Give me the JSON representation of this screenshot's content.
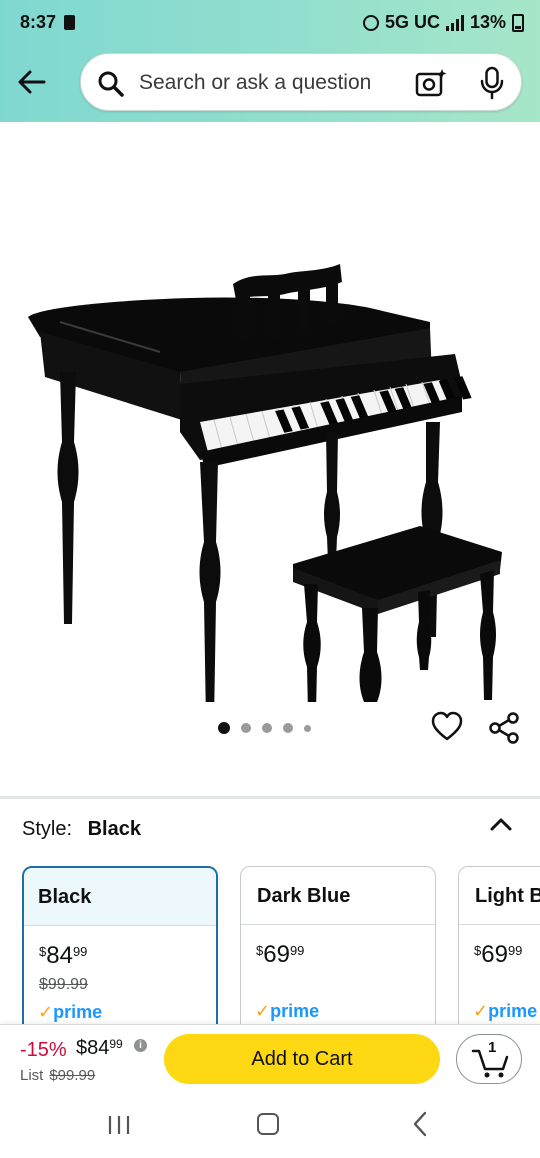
{
  "status_bar": {
    "time": "8:37",
    "network": "5G UC",
    "battery": "13%"
  },
  "search": {
    "placeholder": "Search or ask a question"
  },
  "icons": {
    "back": "back-arrow-icon",
    "search": "search-icon",
    "camera": "camera-search-icon",
    "mic": "microphone-icon",
    "heart": "heart-icon",
    "share": "share-icon",
    "chevron": "chevron-up-icon",
    "cart": "cart-icon"
  },
  "gallery": {
    "image_count": 5,
    "active_index": 0
  },
  "style_selector": {
    "label": "Style:",
    "selected": "Black",
    "options": [
      {
        "name": "Black",
        "price_symbol": "$",
        "price_whole": "84",
        "price_cents": "99",
        "list_price": "$99.99",
        "prime": "prime"
      },
      {
        "name": "Dark Blue",
        "price_symbol": "$",
        "price_whole": "69",
        "price_cents": "99",
        "list_price": "",
        "prime": "prime"
      },
      {
        "name": "Light B",
        "price_symbol": "$",
        "price_whole": "69",
        "price_cents": "99",
        "list_price": "",
        "prime": "prime"
      }
    ]
  },
  "buy_bar": {
    "discount": "-15%",
    "price_whole": "$84",
    "price_cents": "99",
    "list_label": "List",
    "list_price": "$99.99",
    "add_to_cart": "Add to Cart",
    "cart_count": "1"
  },
  "colors": {
    "header_gradient_start": "#7fd8d0",
    "header_gradient_end": "#a7e6c8",
    "add_to_cart": "#ffd814",
    "discount_red": "#cc0c39",
    "prime_blue": "#1a98ff",
    "selected_border": "#1e6fa8"
  }
}
